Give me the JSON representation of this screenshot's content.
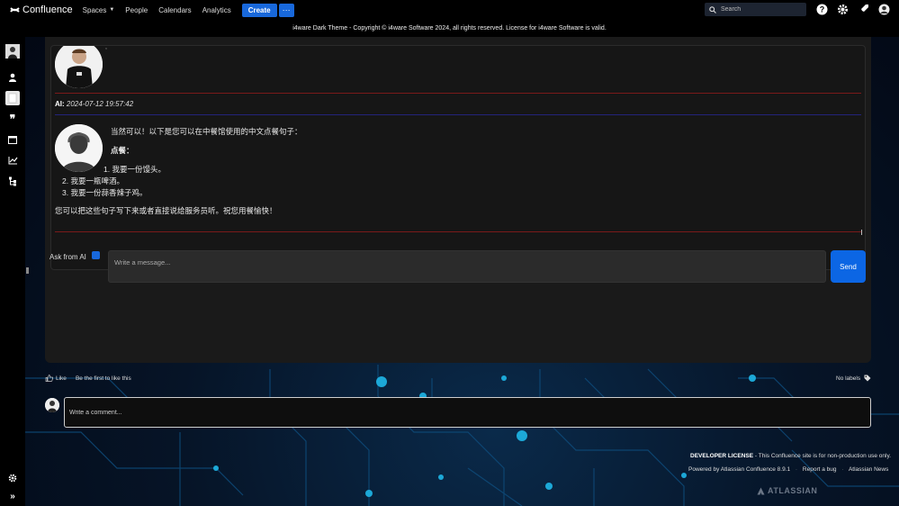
{
  "app": {
    "name": "Confluence"
  },
  "topnav": {
    "items": [
      {
        "label": "Spaces",
        "has_dropdown": true
      },
      {
        "label": "People",
        "has_dropdown": false
      },
      {
        "label": "Calendars",
        "has_dropdown": false
      },
      {
        "label": "Analytics",
        "has_dropdown": false
      }
    ],
    "create_label": "Create",
    "more_label": "···",
    "search_placeholder": "Search",
    "icons": [
      "help-icon",
      "settings-icon",
      "notifications-icon",
      "user-avatar"
    ]
  },
  "banner": {
    "text": "i4ware Dark Theme - Copyright © i4ware Software 2024, all rights reserved. License for i4ware Software is valid."
  },
  "sidebar": {
    "icons": [
      "avatar",
      "person-icon",
      "page-icon",
      "quote-icon",
      "calendar-icon",
      "chart-icon",
      "tree-icon",
      "settings-icon",
      "expand-icon"
    ]
  },
  "chat": {
    "ai_label": "AI:",
    "ai_timestamp": "2024-07-12 19:57:42",
    "response": {
      "intro": "当然可以！以下是您可以在中餐馆使用的中文点餐句子：",
      "heading": "点餐：",
      "items": [
        "我要一份馒头。",
        "我要一瓶啤酒。",
        "我要一份蒜香辣子鸡。"
      ],
      "outro": "您可以把这些句子写下来或者直接说给服务员听。祝您用餐愉快！"
    },
    "ask_label": "Ask from AI",
    "ask_checked": true,
    "message_placeholder": "Write a message...",
    "send_label": "Send"
  },
  "page_footer": {
    "like_label": "Like",
    "like_hint": "Be the first to like this",
    "labels_label": "No labels",
    "comment_placeholder": "Write a comment..."
  },
  "footer": {
    "license_bold": "DEVELOPER LICENSE",
    "license_text": " - This Confluence site is for non-production use only.",
    "powered": "Powered by Atlassian Confluence 8.9.1",
    "report_bug": "Report a bug",
    "news": "Atlassian News",
    "brand": "ATLASSIAN"
  },
  "colors": {
    "accent": "#1868db",
    "send": "#0c66e4",
    "panel": "#1a1a1a",
    "divider_red": "#7a1a1a",
    "divider_blue": "#23237a"
  }
}
